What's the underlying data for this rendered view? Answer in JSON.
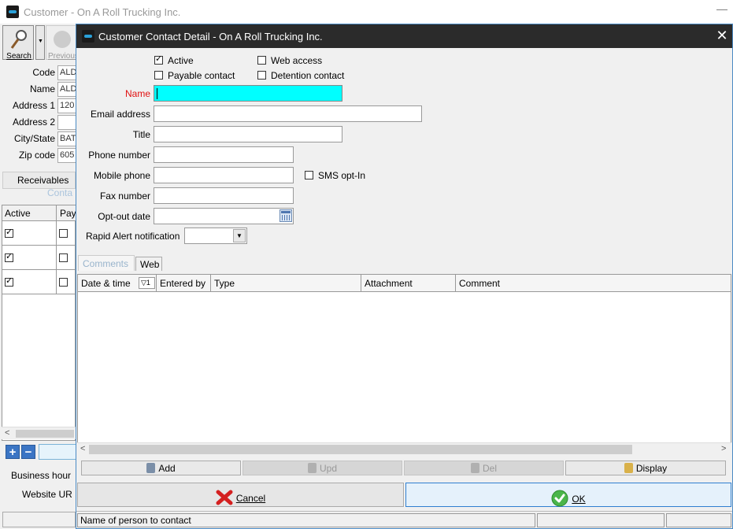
{
  "parent": {
    "title": "Customer - On A Roll Trucking Inc.",
    "toolbar": {
      "search_label": "Search",
      "previous_label": "Previous"
    },
    "fields": [
      {
        "label": "Code",
        "value": "ALD"
      },
      {
        "label": "Name",
        "value": "ALD"
      },
      {
        "label": "Address 1",
        "value": "120"
      },
      {
        "label": "Address 2",
        "value": ""
      },
      {
        "label": "City/State",
        "value": "BAT"
      },
      {
        "label": "Zip code",
        "value": "605"
      }
    ],
    "tabs": {
      "receivables": "Receivables",
      "contacts": "Conta"
    },
    "grid": {
      "headers": [
        "Active",
        "Pay"
      ],
      "rows": [
        {
          "active": true,
          "payable": false
        },
        {
          "active": true,
          "payable": false
        },
        {
          "active": true,
          "payable": false
        }
      ]
    },
    "bottom_labels": [
      "Business hour",
      "Website UR"
    ]
  },
  "dialog": {
    "title": "Customer Contact Detail - On A Roll Trucking Inc.",
    "checkboxes": {
      "active": {
        "label": "Active",
        "checked": true
      },
      "web_access": {
        "label": "Web access",
        "checked": false
      },
      "payable": {
        "label": "Payable contact",
        "checked": false
      },
      "detention": {
        "label": "Detention contact",
        "checked": false
      },
      "sms": {
        "label": "SMS opt-In",
        "checked": false
      }
    },
    "labels": {
      "name": "Name",
      "email": "Email address",
      "title": "Title",
      "phone": "Phone number",
      "mobile": "Mobile phone",
      "fax": "Fax number",
      "optout": "Opt-out date",
      "rapid": "Rapid Alert notification"
    },
    "values": {
      "name": "",
      "email": "",
      "title": "",
      "phone": "",
      "mobile": "",
      "fax": "",
      "optout": "",
      "rapid": ""
    },
    "tabs": {
      "comments": "Comments",
      "web": "Web"
    },
    "grid": {
      "headers": {
        "date_time": "Date & time",
        "sort_indicator": "1",
        "entered_by": "Entered by",
        "type": "Type",
        "attachment": "Attachment",
        "comment": "Comment"
      },
      "rows": []
    },
    "buttons": {
      "add": "Add",
      "upd": "Upd",
      "del": "Del",
      "display": "Display",
      "cancel": "Cancel",
      "ok": "OK"
    },
    "status": {
      "message": "Name of person to contact"
    },
    "colors": {
      "name_label": "#e01010",
      "active_field": "#00ffff",
      "titlebar": "#2b2b2b"
    }
  }
}
